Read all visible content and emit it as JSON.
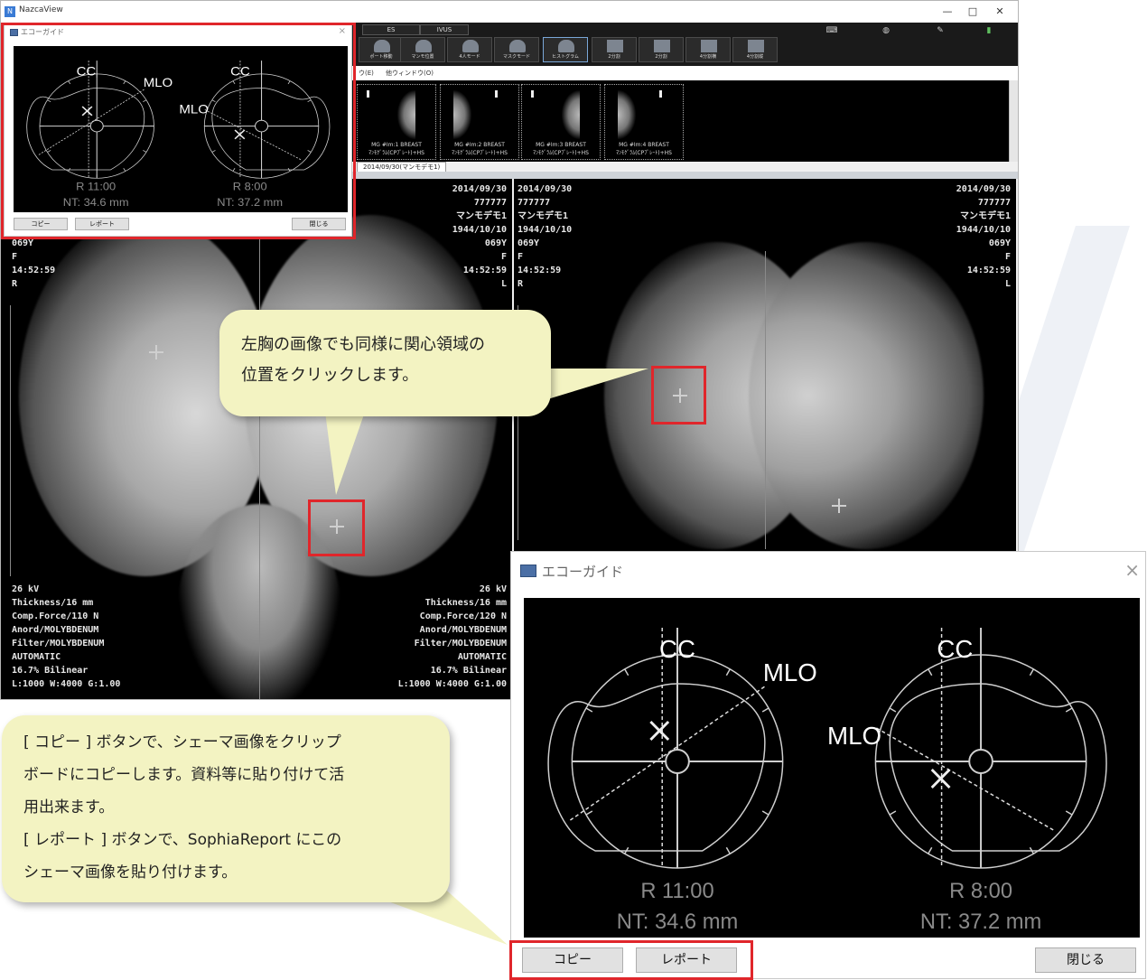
{
  "app": {
    "title": "NazcaView",
    "window_controls": {
      "minimize": "—",
      "maximize": "□",
      "close": "✕"
    }
  },
  "toolbar": {
    "tabs": [
      "ES",
      "IVUS"
    ],
    "buttons": [
      "ポート移動",
      "マンモ位置",
      "4人モード",
      "マスクモード",
      "ヒストグラム",
      "2分割",
      "2分割",
      "4分割横",
      "4分割縦"
    ]
  },
  "menubar": {
    "items": [
      "ウ(E)",
      "他ウィンドウ(O)"
    ]
  },
  "thumbnails": [
    {
      "caption": "MG #Im:1 BREAST\nﾏﾝﾓｸﾞﾗﾑ(CPﾌﾟﾚｰﾄ)+HS"
    },
    {
      "caption": "MG #Im:2 BREAST\nﾏﾝﾓｸﾞﾗﾑ(CPﾌﾟﾚｰﾄ)+HS"
    },
    {
      "caption": "MG #Im:3 BREAST\nﾏﾝﾓｸﾞﾗﾑ(CPﾌﾟﾚｰﾄ)+HS"
    },
    {
      "caption": "MG #Im:4 BREAST\nﾏﾝﾓｸﾞﾗﾑ(CPﾌﾟﾚｰﾄ)+HS"
    }
  ],
  "study_tab": "2014/09/30(マンモデモ1)",
  "viewers": {
    "left": {
      "top_right": "2014/09/30\n777777\nマンモデモ1\n1944/10/10\n069Y\nF\n14:52:59\nL",
      "top_left": "069Y\nF\n14:52:59\nR",
      "bottom_left": "26 kV\nThickness/16 mm\nComp.Force/110 N\nAnord/MOLYBDENUM\nFilter/MOLYBDENUM\nAUTOMATIC\n16.7% Bilinear\nL:1000 W:4000 G:1.00",
      "bottom_right": "26 kV\nThickness/16 mm\nComp.Force/120 N\nAnord/MOLYBDENUM\nFilter/MOLYBDENUM\nAUTOMATIC\n16.7% Bilinear\nL:1000 W:4000 G:1.00"
    },
    "right": {
      "top_left": "2014/09/30\n777777\nマンモデモ1\n1944/10/10\n069Y\nF\n14:52:59\nR",
      "top_right": "2014/09/30\n777777\nマンモデモ1\n1944/10/10\n069Y\nF\n14:52:59\nL"
    }
  },
  "small_dialog": {
    "title": "エコーガイド",
    "close": "×",
    "labels": {
      "cc": "CC",
      "mlo": "MLO"
    },
    "left_reading": "R 11:00",
    "left_nt": "NT: 34.6 mm",
    "right_reading": "R 8:00",
    "right_nt": "NT: 37.2 mm",
    "buttons": {
      "copy": "コピー",
      "report": "レポート",
      "close": "閉じる"
    }
  },
  "large_dialog": {
    "title": "エコーガイド",
    "close": "×",
    "labels": {
      "cc": "CC",
      "mlo": "MLO"
    },
    "left_reading": "R  11:00",
    "left_nt": "NT: 34.6 mm",
    "right_reading": "R  8:00",
    "right_nt": "NT: 37.2 mm",
    "buttons": {
      "copy": "コピー",
      "report": "レポート",
      "close": "閉じる"
    }
  },
  "callouts": {
    "top": "左胸の画像でも同様に関心領域の\n位置をクリックします。",
    "bottom": "[ コピー ] ボタンで、シェーマ画像をクリップ\nボードにコピーします。資料等に貼り付けて活\n用出来ます。\n[ レポート ] ボタンで、SophiaReport にこの\nシェーマ画像を貼り付けます。"
  },
  "colors": {
    "highlight": "#e0262b",
    "callout_bg": "#f3f3c2"
  }
}
